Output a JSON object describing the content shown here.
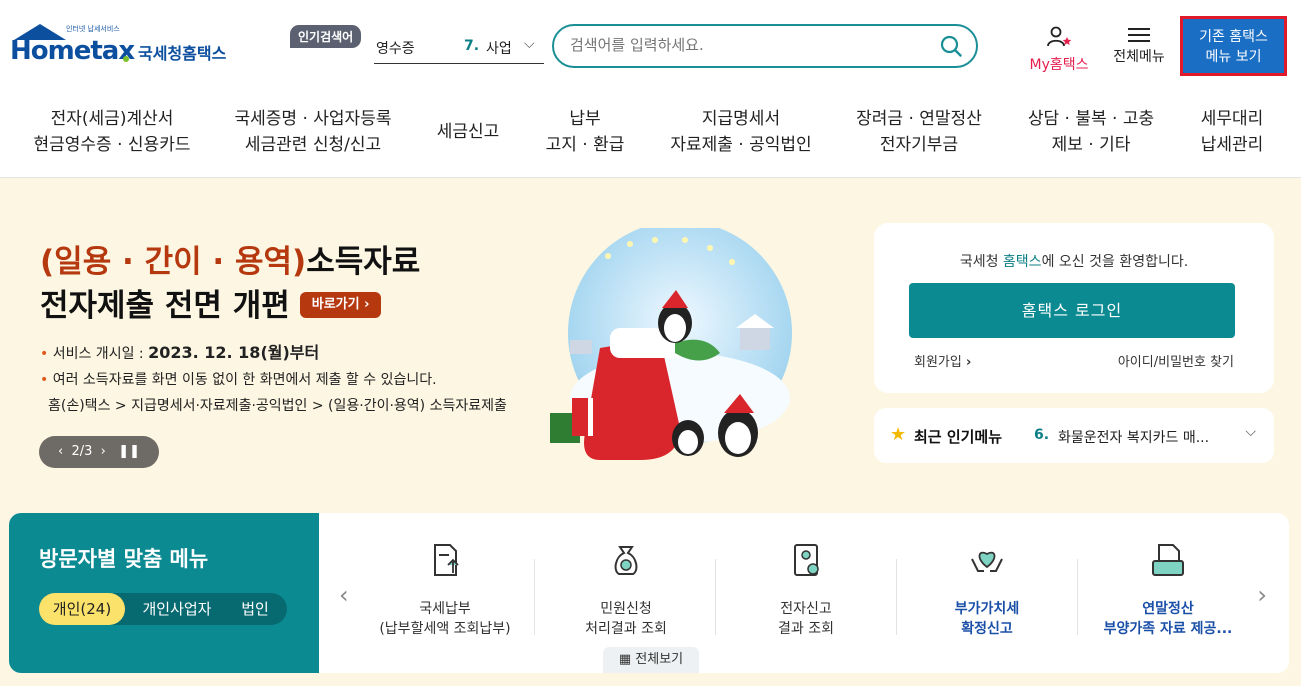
{
  "header": {
    "logo_tagline": "인터넷 납세서비스",
    "logo_word": "Hometax",
    "logo_kr": "국세청홈택스",
    "popular_badge": "인기검색어",
    "popular_left": "영수증",
    "popular_num": "7.",
    "popular_item": "사업",
    "search_placeholder": "검색어를 입력하세요.",
    "my_hometax": "My홈택스",
    "all_menu": "전체메뉴",
    "legacy_line1": "기존 홈택스",
    "legacy_line2": "메뉴 보기"
  },
  "nav": [
    {
      "l1": "전자(세금)계산서",
      "l2": "현금영수증 · 신용카드"
    },
    {
      "l1": "국세증명 · 사업자등록",
      "l2": "세금관련 신청/신고"
    },
    {
      "l1": "세금신고",
      "l2": ""
    },
    {
      "l1": "납부",
      "l2": "고지 · 환급"
    },
    {
      "l1": "지급명세서",
      "l2": "자료제출 · 공익법인"
    },
    {
      "l1": "장려금 · 연말정산",
      "l2": "전자기부금"
    },
    {
      "l1": "상담 · 불복 · 고충",
      "l2": "제보 · 기타"
    },
    {
      "l1": "세무대리",
      "l2": "납세관리"
    }
  ],
  "hero": {
    "title_hl": "(일용 · 간이 · 용역)",
    "title_rest": "소득자료",
    "title_line2": "전자제출 전면 개편",
    "go_button": "바로가기",
    "info1_label": "서비스 개시일 : ",
    "info1_value": "2023. 12. 18(월)부터",
    "info2": "여러 소득자료를 화면 이동 없이 한 화면에서 제출 할 수 있습니다.",
    "info3": "홈(손)택스 > 지급명세서·자료제출·공익법인 > (일용·간이·용역) 소득자료제출",
    "pager": "2/3"
  },
  "welcome": {
    "pre": "국세청 ",
    "brand": "홈택스",
    "post": "에 오신 것을 환영합니다.",
    "login": "홈택스 로그인",
    "join": "회원가입",
    "find": "아이디/비밀번호 찾기"
  },
  "recent": {
    "label": "최근 인기메뉴",
    "num": "6.",
    "item": "화물운전자 복지카드 매..."
  },
  "visitor": {
    "title": "방문자별 맞춤 메뉴",
    "tabs": [
      "개인(24)",
      "개인사업자",
      "법인"
    ],
    "services": [
      {
        "l1": "국세납부",
        "l2": "(납부할세액 조회납부)",
        "hl": false,
        "icon": "document-arrow-icon"
      },
      {
        "l1": "민원신청",
        "l2": "처리결과 조회",
        "hl": false,
        "icon": "money-bag-icon"
      },
      {
        "l1": "전자신고",
        "l2": "결과 조회",
        "hl": false,
        "icon": "certificate-icon"
      },
      {
        "l1": "부가가치세",
        "l2": "확정신고",
        "hl": true,
        "icon": "hands-heart-icon"
      },
      {
        "l1": "연말정산",
        "l2": "부양가족 자료 제공...",
        "hl": true,
        "icon": "folder-doc-icon"
      }
    ],
    "view_all": "전체보기"
  },
  "colors": {
    "teal": "#0b8a92",
    "hero_bg": "#fcf6e2",
    "accent_red": "#b5380f",
    "legacy_blue": "#1a6ec4"
  }
}
